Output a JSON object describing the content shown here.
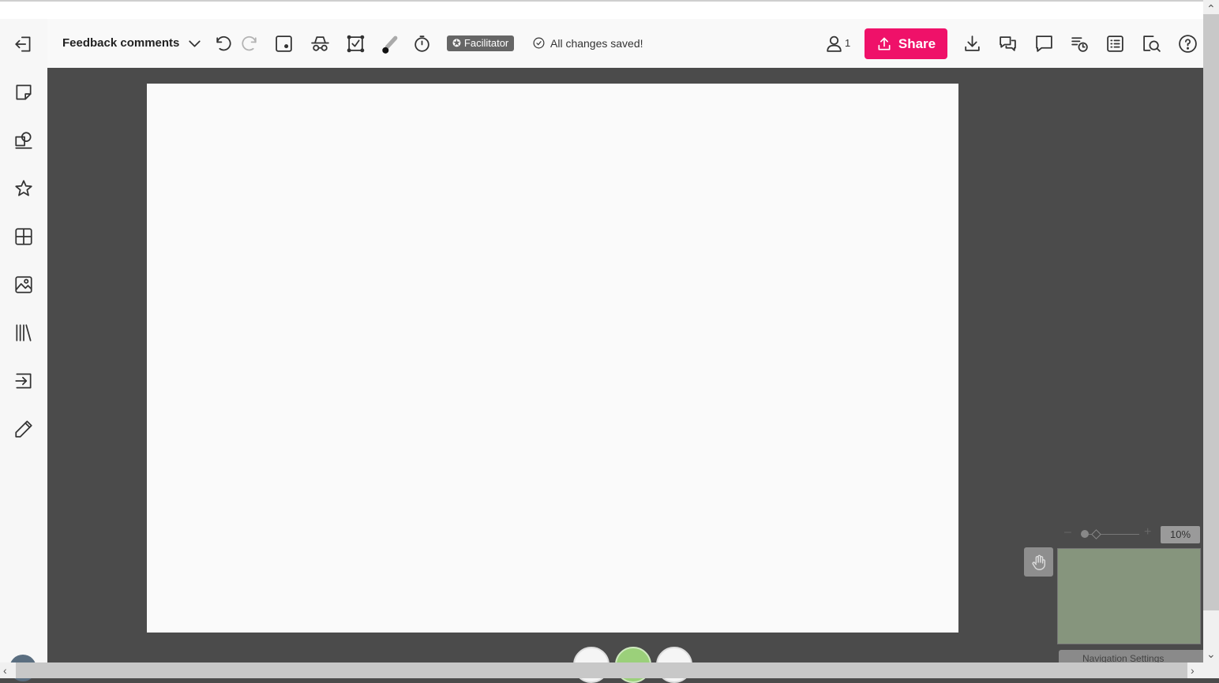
{
  "toolbar": {
    "board_title": "Feedback comments",
    "facilitator_label": "Facilitator",
    "saved_status": "All changes saved!",
    "share_label": "Share",
    "users_count": "1"
  },
  "sidebar": {
    "items": [
      {
        "icon": "exit-board-icon"
      },
      {
        "icon": "sticky-note-icon"
      },
      {
        "icon": "shapes-icon"
      },
      {
        "icon": "star-icon"
      },
      {
        "icon": "grid-icon"
      },
      {
        "icon": "image-icon"
      },
      {
        "icon": "library-icon"
      },
      {
        "icon": "import-icon"
      },
      {
        "icon": "pen-icon"
      }
    ]
  },
  "zoom": {
    "level": "10%"
  },
  "navigation": {
    "settings_label": "Navigation Settings"
  },
  "colors": {
    "accent": "#ef1169",
    "canvas_background": "#4b4b4b",
    "page": "#fafafa",
    "minimap": "#86957d"
  }
}
